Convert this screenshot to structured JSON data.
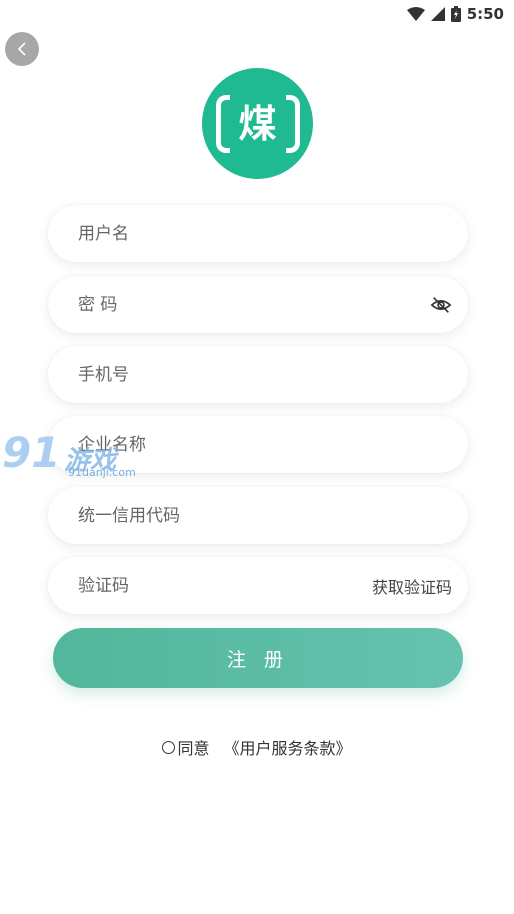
{
  "status_bar": {
    "time": "5:50"
  },
  "logo": {
    "text": "煤"
  },
  "form": {
    "username_placeholder": "用户名",
    "password_placeholder": "密 码",
    "phone_placeholder": "手机号",
    "company_placeholder": "企业名称",
    "credit_code_placeholder": "统一信用代码",
    "verify_code_placeholder": "验证码",
    "get_code_label": "获取验证码"
  },
  "register_button": "注 册",
  "agreement": {
    "agree_label": "同意",
    "terms_label": "《用户服务条款》"
  },
  "watermark": {
    "number": "91",
    "cn": "游戏",
    "url": "91danji.com"
  },
  "colors": {
    "brand": "#1fb992",
    "button": "#52b79b"
  },
  "icons": [
    "back-icon",
    "wifi-icon",
    "signal-icon",
    "battery-icon",
    "eye-off-icon",
    "radio-icon"
  ]
}
